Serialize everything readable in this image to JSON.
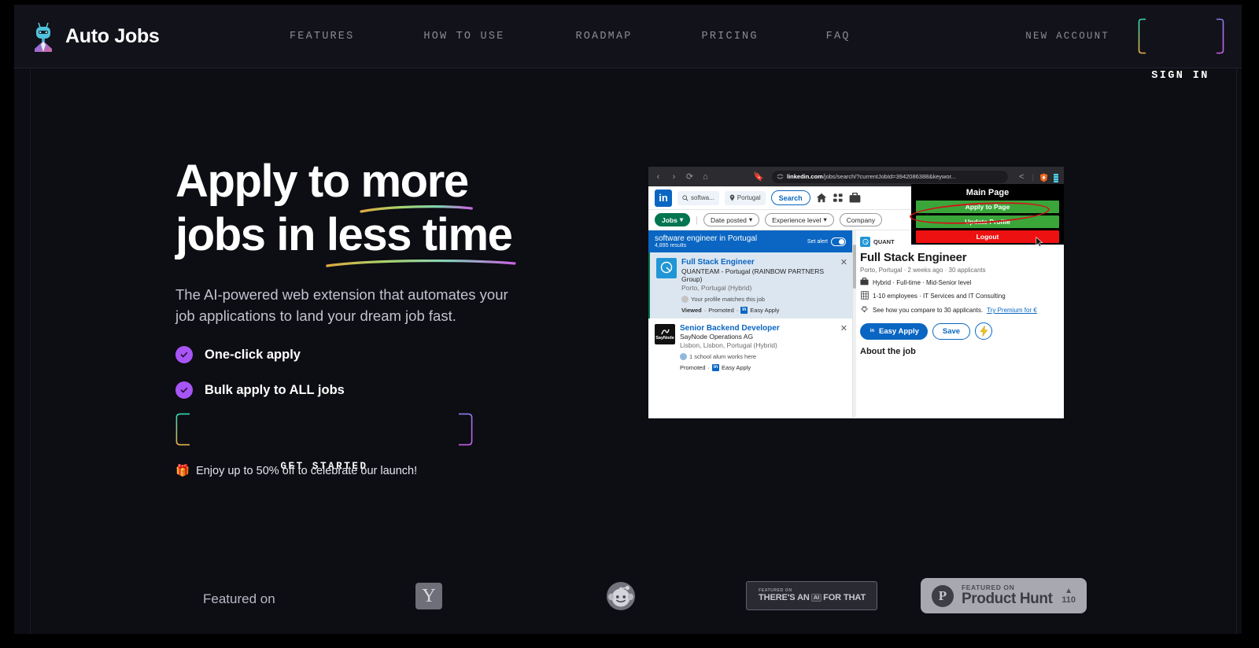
{
  "brand": {
    "name": "Auto Jobs",
    "logo_icon": "robot-bot-icon"
  },
  "nav": {
    "items": [
      {
        "label": "FEATURES"
      },
      {
        "label": "HOW TO USE"
      },
      {
        "label": "ROADMAP"
      },
      {
        "label": "PRICING"
      },
      {
        "label": "FAQ"
      }
    ],
    "new_account": "NEW ACCOUNT",
    "sign_in": "SIGN IN"
  },
  "hero": {
    "headline_part1": "Apply to ",
    "headline_more": "more",
    "headline_part2": "jobs in ",
    "headline_less": "less time",
    "subtitle": "The AI-powered web extension that automates your job applications to land your dream job fast.",
    "features": [
      {
        "label": "One-click apply",
        "icon": "check-circle-icon"
      },
      {
        "label": "Bulk apply to ALL jobs",
        "icon": "check-circle-icon"
      }
    ],
    "cta": "GET STARTED",
    "promo": "Enjoy up to 50% off to celebrate our launch!",
    "promo_emoji": "🎁"
  },
  "featured": {
    "label": "Featured on",
    "hackernews": {
      "icon": "hacker-news-icon",
      "mark": "Y"
    },
    "reddit": {
      "icon": "reddit-icon"
    },
    "taft": {
      "small": "FEATURED ON",
      "big_pre": "THERE'S AN",
      "chip": "AI",
      "big_post": "FOR THAT"
    },
    "producthunt": {
      "icon": "product-hunt-icon",
      "mark": "P",
      "small": "FEATURED ON",
      "big": "Product Hunt",
      "votes": "110",
      "caret": "▲"
    }
  },
  "screenshot": {
    "browser": {
      "url_domain": "linkedin.com",
      "url_path": "/jobs/search/?currentJobId=3942086388&keywor...",
      "icons": [
        "back-icon",
        "forward-icon",
        "reload-icon",
        "home-icon",
        "bookmark-icon",
        "sync-icon",
        "share-icon",
        "brave-shield-icon",
        "extension-icon"
      ]
    },
    "linkedin": {
      "logo": "in",
      "search_keyword": "softwa...",
      "search_location": "Portugal",
      "search_button": "Search",
      "nav_icons": [
        "home-icon",
        "network-icon",
        "jobs-icon"
      ],
      "filters": [
        "Jobs",
        "Date posted",
        "Experience level",
        "Company"
      ],
      "results_header": {
        "title": "software engineer in Portugal",
        "count": "4,895 results",
        "alert_label": "Set alert"
      },
      "jobs": [
        {
          "title": "Full Stack Engineer",
          "company": "QUANTEAM - Portugal (RAINBOW PARTNERS Group)",
          "location": "Porto, Portugal (Hybrid)",
          "meta": "Your profile matches this job",
          "footer_viewed": "Viewed",
          "footer_promoted": "Promoted",
          "footer_easy": "Easy Apply",
          "logo_text": "Q",
          "logo_color": "#2196d6",
          "selected": true
        },
        {
          "title": "Senior Backend Developer",
          "company": "SayNode Operations AG",
          "location": "Lisbon, Lisbon, Portugal (Hybrid)",
          "meta": "1 school alum works here",
          "footer_promoted": "Promoted",
          "footer_easy": "Easy Apply",
          "logo_text": "SayNode",
          "logo_color": "#111111",
          "selected": false
        }
      ],
      "detail": {
        "company_short": "QUANT",
        "title": "Full Stack Engineer",
        "subline": "Porto, Portugal · 2 weeks ago · 30 applicants",
        "row_work": "Hybrid · Full-time · Mid-Senior level",
        "row_size": "1-10 employees · IT Services and IT Consulting",
        "row_compare": "See how you compare to 30 applicants.",
        "row_premium": "Try Premium for €",
        "btn_apply": "Easy Apply",
        "btn_save": "Save",
        "about": "About the job"
      }
    },
    "extension": {
      "title": "Main Page",
      "buttons": [
        {
          "label": "Apply to Page",
          "style": "green",
          "highlighted": true
        },
        {
          "label": "Update Profile",
          "style": "green",
          "highlighted": false
        },
        {
          "label": "Logout",
          "style": "red",
          "highlighted": false
        }
      ]
    }
  },
  "colors": {
    "bg": "#0d0d14",
    "accent_purple": "#a855f7",
    "linkedin_blue": "#0a66c2",
    "green": "#3aa63a",
    "red": "#ee1111"
  }
}
